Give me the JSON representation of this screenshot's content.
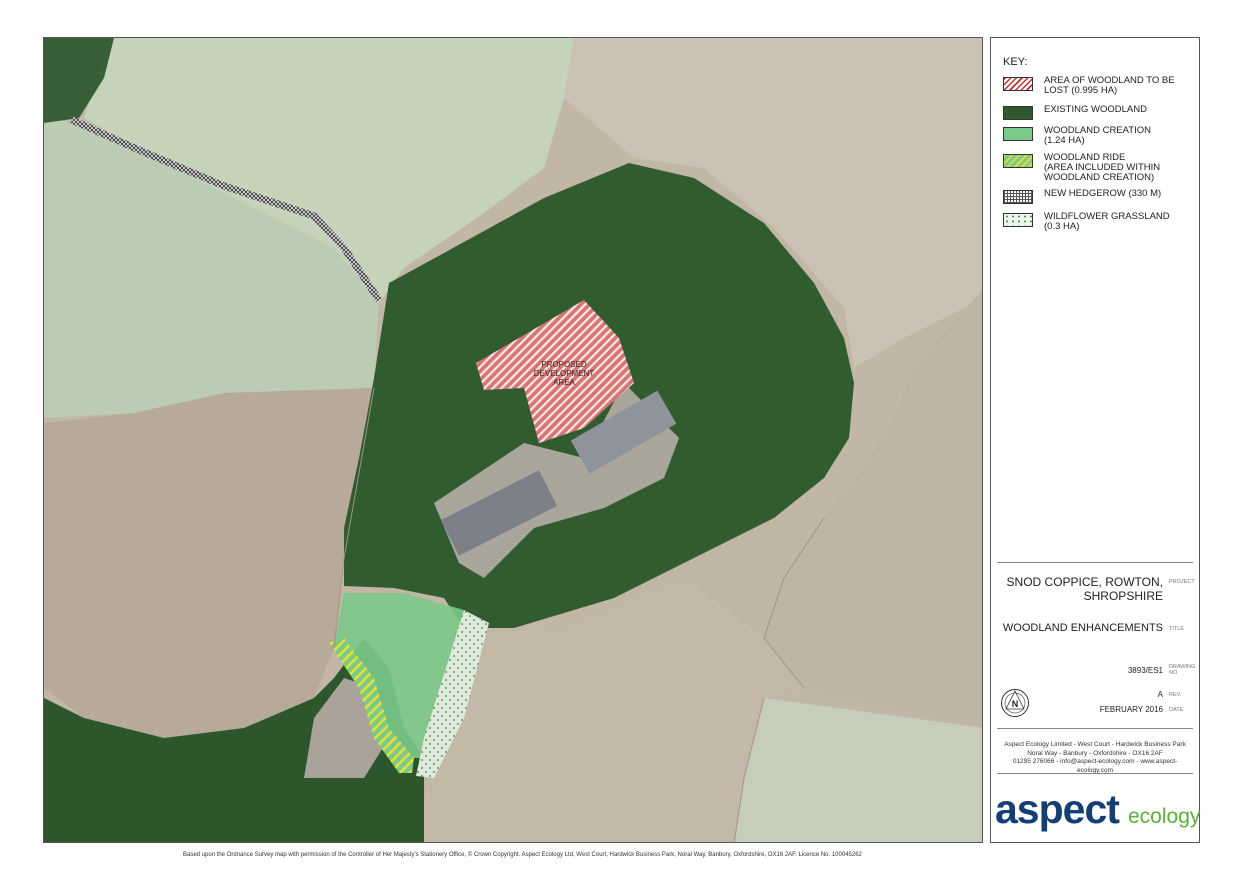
{
  "map": {
    "development_label": "PROPOSED\nDEVELOPMENT\nAREA"
  },
  "key": {
    "title": "KEY:",
    "items": [
      {
        "label": "AREA OF WOODLAND TO BE\nLOST (0.995 HA)",
        "pattern": "red-hatch",
        "color": "#c0302c"
      },
      {
        "label": "EXISTING WOODLAND",
        "pattern": "solid",
        "color": "#2f5a2f"
      },
      {
        "label": "WOODLAND CREATION\n(1.24 HA)",
        "pattern": "solid",
        "color": "#7cc98a"
      },
      {
        "label": "WOODLAND RIDE\n(AREA INCLUDED WITHIN\nWOODLAND CREATION)",
        "pattern": "yellow-hatch",
        "color": "#d8dc3c"
      },
      {
        "label": "NEW HEDGEROW (330 M)",
        "pattern": "grid",
        "color": "#555555"
      },
      {
        "label": "WILDFLOWER GRASSLAND\n(0.3 HA)",
        "pattern": "dots",
        "color": "#3a9a4a"
      }
    ]
  },
  "title_block": {
    "project": "SNOD COPPICE, ROWTON,\nSHROPSHIRE",
    "project_label": "PROJECT",
    "title": "WOODLAND ENHANCEMENTS",
    "title_label": "TITLE",
    "drawing_no": "3893/ES1",
    "drawing_no_label": "DRAWING\nNO.",
    "rev": "A",
    "rev_label": "REV.",
    "date": "FEBRUARY 2016",
    "date_label": "DATE",
    "north_symbol": "N",
    "company_address": "Aspect Ecology Limited - West Court - Hardwick Business Park\nNoral Way - Banbury - Oxfordshire - OX16 2AF\n01295 276066 - info@aspect-ecology.com - www.aspect-ecology.com",
    "logo_main": "aspect",
    "logo_sub": "ecology"
  },
  "footer": {
    "text": "Based upon the Ordnance Survey map with permission of the Controller of Her Majesty's Stationery Office, © Crown Copyright. Aspect Ecology Ltd, West Court, Hardwick Business Park, Noral Way, Banbury, Oxfordshire, OX16 2AF. Licence No. 100045262"
  },
  "colors": {
    "field_dark": "#b8a898",
    "field_green": "#b8ccb0",
    "woodland": "#2f5a2f",
    "woodland_creation": "#7cc98a",
    "lost_area": "#c0302c",
    "logo_blue": "#153e72",
    "logo_green": "#5cae3c"
  }
}
